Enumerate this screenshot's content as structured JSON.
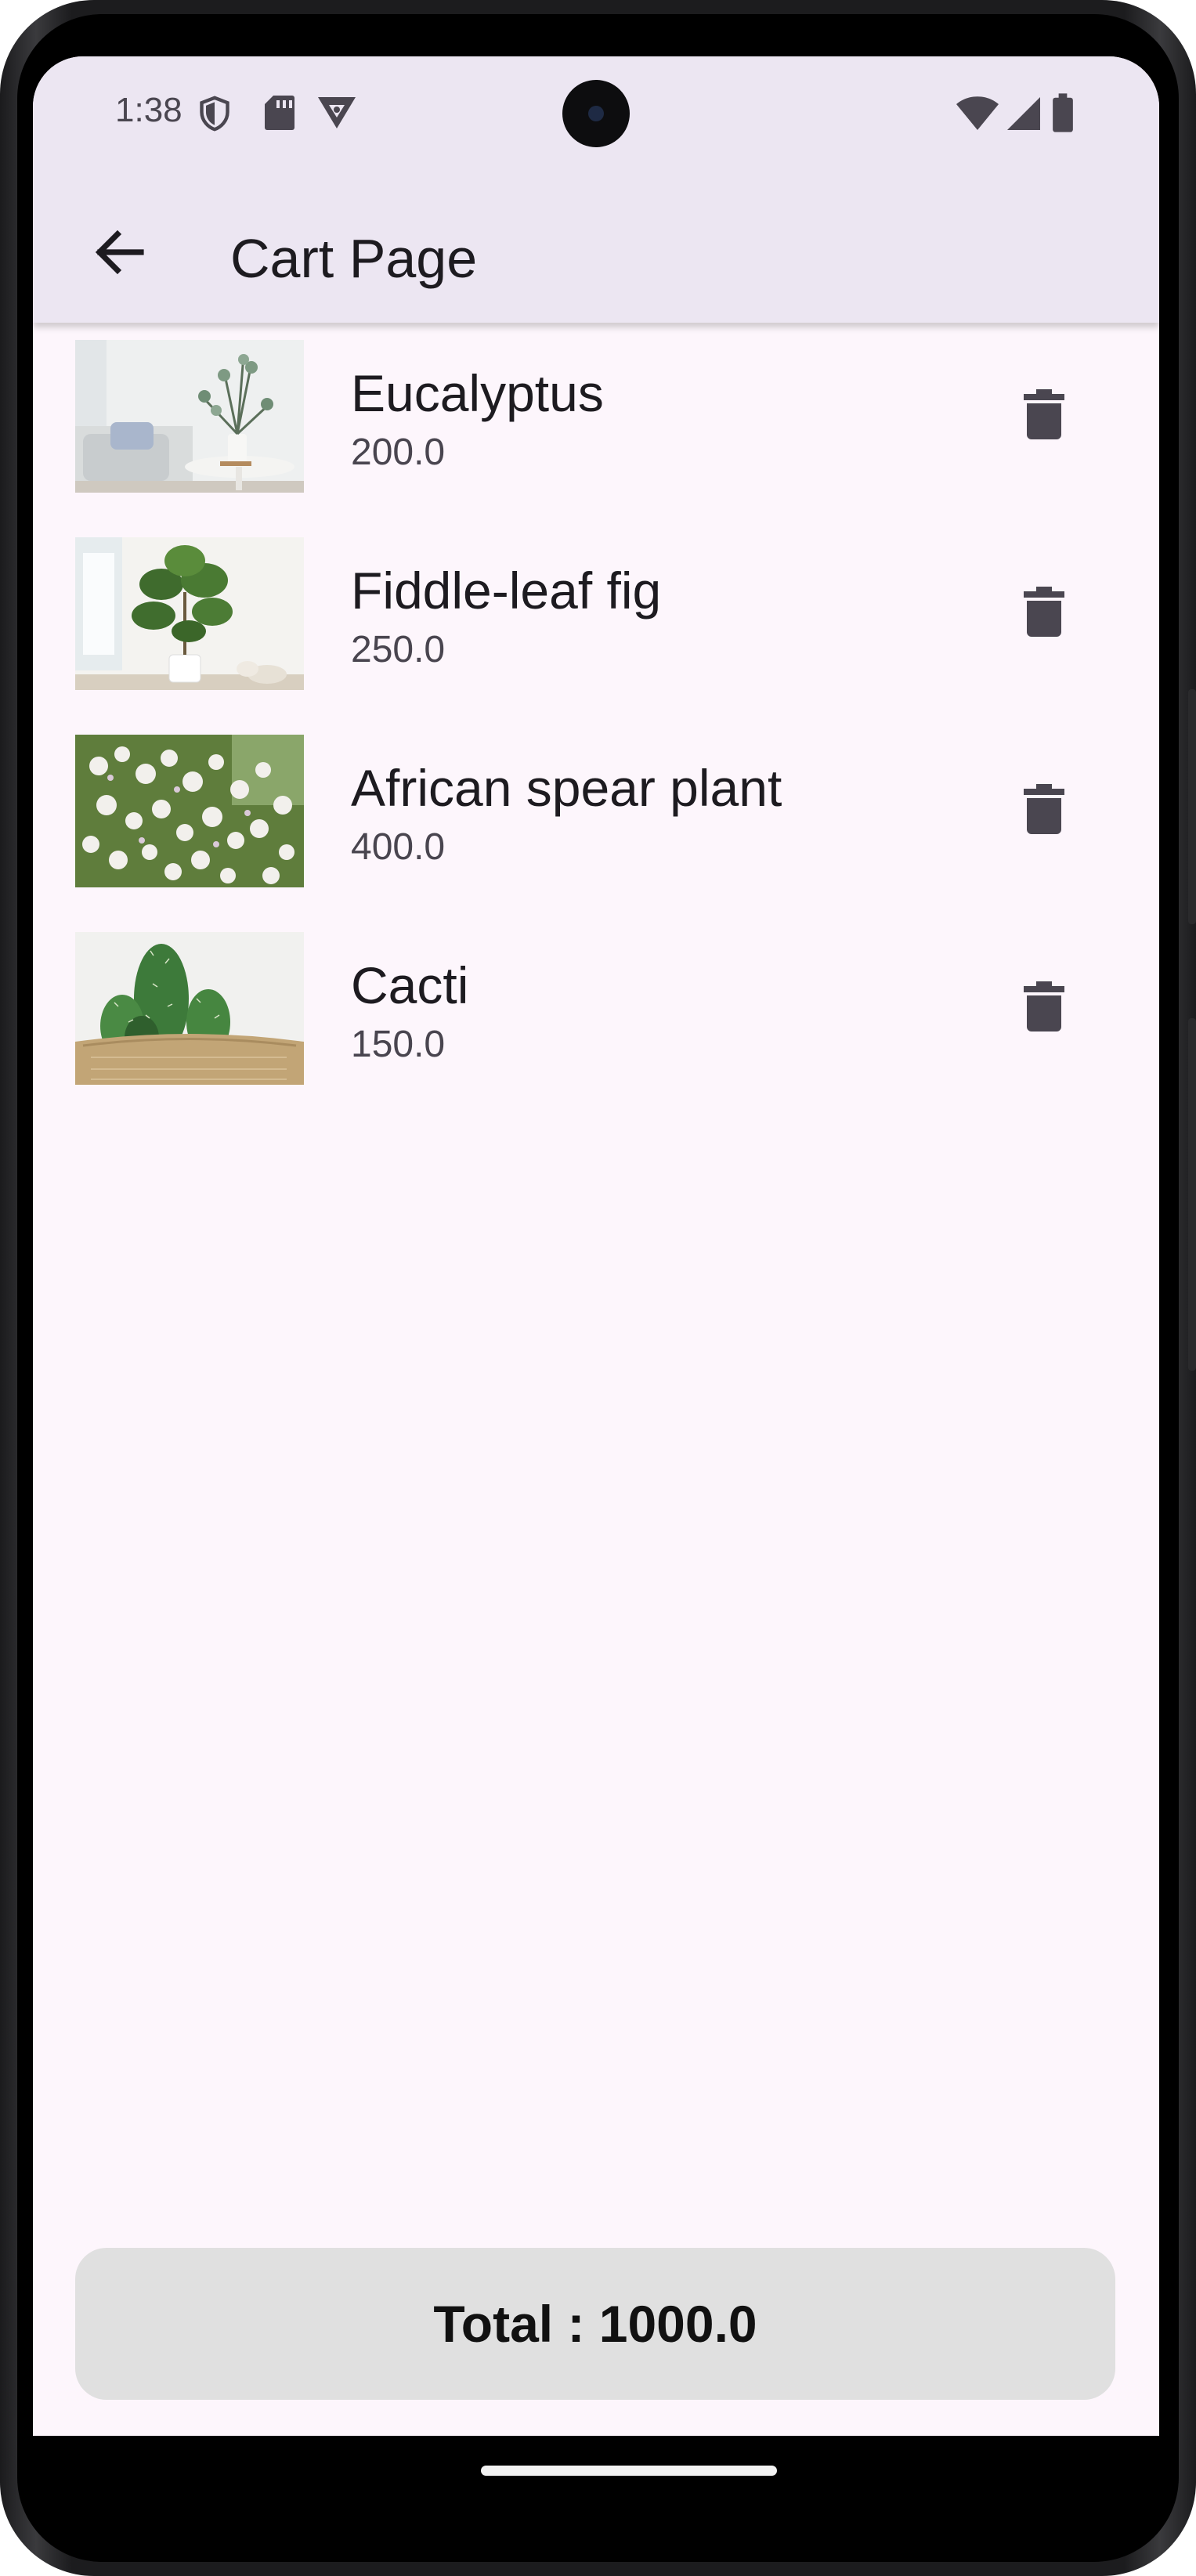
{
  "status_bar": {
    "time": "1:38",
    "left_icons": [
      "shield-icon",
      "sd-card-icon",
      "vpn-key-icon"
    ],
    "right_icons": [
      "wifi-icon",
      "cell-signal-icon",
      "battery-icon"
    ]
  },
  "app_bar": {
    "back_icon": "arrow-back-icon",
    "title": "Cart Page"
  },
  "cart": {
    "items": [
      {
        "name": "Eucalyptus",
        "price": "200.0",
        "image": "eucalyptus-photo"
      },
      {
        "name": "Fiddle-leaf fig",
        "price": "250.0",
        "image": "fiddle-leaf-fig-photo"
      },
      {
        "name": "African spear plant",
        "price": "400.0",
        "image": "african-spear-plant-photo"
      },
      {
        "name": "Cacti",
        "price": "150.0",
        "image": "cacti-photo"
      }
    ]
  },
  "total": {
    "label": "Total : 1000.0"
  },
  "colors": {
    "app_bar_bg": "#ece6f2",
    "page_bg": "#fdf6fc",
    "total_bg": "#e0e0e0",
    "icon_color": "#4a4650"
  }
}
